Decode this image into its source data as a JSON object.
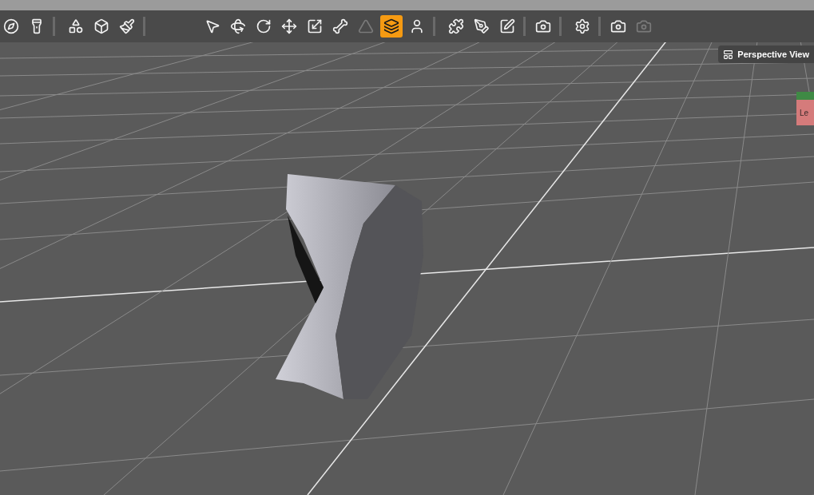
{
  "toolbar": {
    "groups": [
      [
        {
          "kind": "compass",
          "selected": false,
          "disabled": false
        },
        {
          "kind": "spotlight",
          "selected": false,
          "disabled": false
        }
      ],
      [
        {
          "kind": "primitive",
          "selected": false,
          "disabled": false
        },
        {
          "kind": "cube",
          "selected": false,
          "disabled": false
        },
        {
          "kind": "paint",
          "selected": false,
          "disabled": false
        }
      ],
      [
        {
          "kind": "pointer",
          "selected": false,
          "disabled": false
        },
        {
          "kind": "orbit",
          "selected": false,
          "disabled": false
        },
        {
          "kind": "rotate",
          "selected": false,
          "disabled": false
        },
        {
          "kind": "move",
          "selected": false,
          "disabled": false
        },
        {
          "kind": "scale",
          "selected": false,
          "disabled": false
        },
        {
          "kind": "bone",
          "selected": false,
          "disabled": false
        },
        {
          "kind": "triangle",
          "selected": false,
          "disabled": true
        },
        {
          "kind": "layers",
          "selected": true,
          "disabled": false
        },
        {
          "kind": "figure",
          "selected": false,
          "disabled": false
        }
      ],
      [
        {
          "kind": "puzzle",
          "selected": false,
          "disabled": false
        },
        {
          "kind": "brush",
          "selected": false,
          "disabled": false
        },
        {
          "kind": "edit",
          "selected": false,
          "disabled": false
        }
      ],
      [
        {
          "kind": "camera",
          "selected": false,
          "disabled": false
        }
      ],
      [
        {
          "kind": "settings",
          "selected": false,
          "disabled": false
        }
      ],
      [
        {
          "kind": "camera",
          "selected": false,
          "disabled": false
        },
        {
          "kind": "camera-settings",
          "selected": false,
          "disabled": true
        }
      ]
    ]
  },
  "viewport": {
    "view_label": "Perspective View",
    "nav_cube_label": "Le"
  }
}
